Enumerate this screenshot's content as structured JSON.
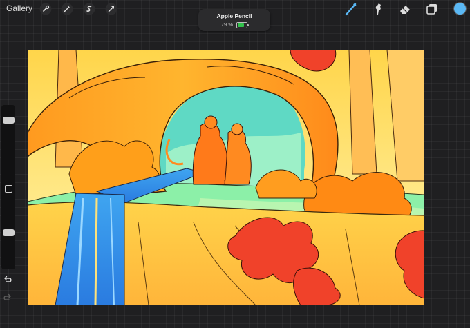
{
  "app": {
    "gallery_label": "Gallery"
  },
  "toolbar_left": [
    {
      "name": "actions-icon"
    },
    {
      "name": "adjustments-icon"
    },
    {
      "name": "selection-icon"
    },
    {
      "name": "transform-icon"
    }
  ],
  "toolbar_right": [
    {
      "name": "brush-icon"
    },
    {
      "name": "smudge-icon"
    },
    {
      "name": "eraser-icon"
    },
    {
      "name": "layers-icon"
    }
  ],
  "pencil": {
    "title": "Apple Pencil",
    "battery_text": "79 %",
    "battery_level": 0.79
  },
  "colors": {
    "active_color": "#5ab8f5",
    "accent_blue": "#5ab8f5",
    "battery_green": "#33c24d"
  },
  "sidebar": {
    "brush_size_level": 0.82,
    "opacity_level": 0.36
  }
}
